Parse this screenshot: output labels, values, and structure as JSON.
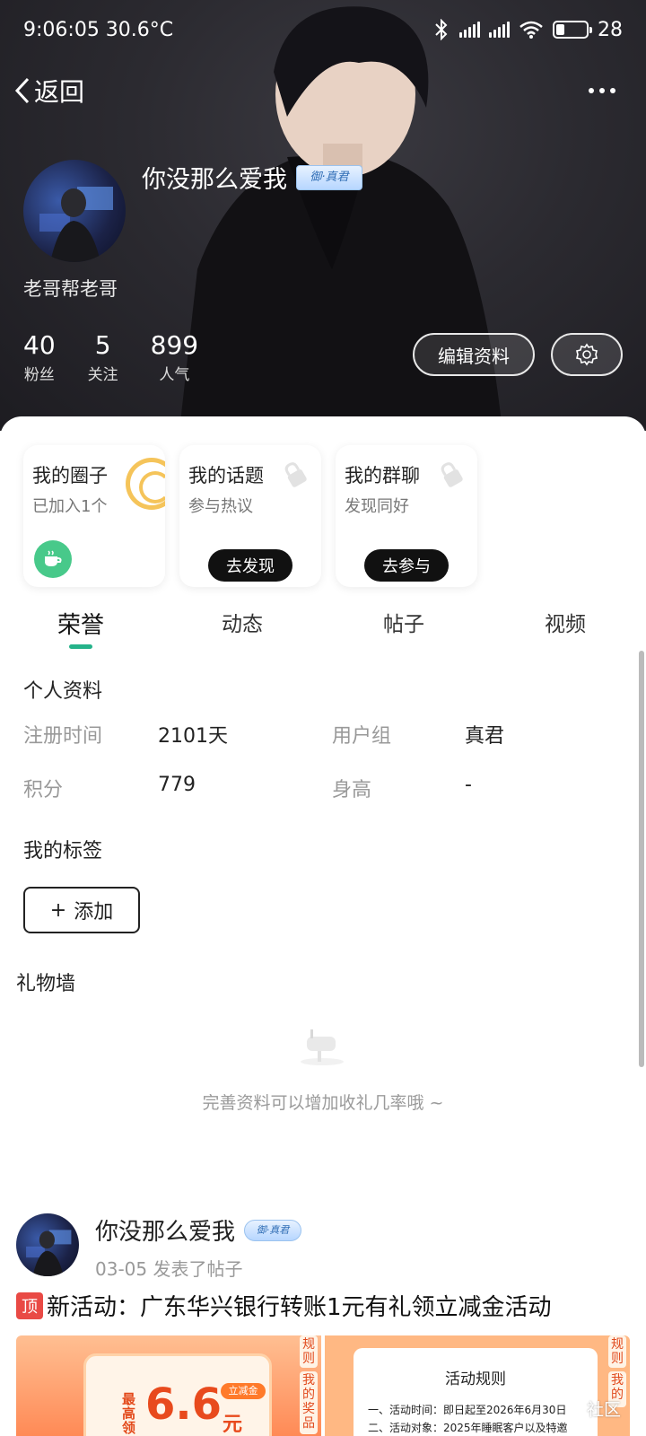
{
  "status_bar": {
    "time_temp": "9:06:05 30.6°C",
    "battery": "28",
    "battery_level": 0.28
  },
  "nav": {
    "back_label": "返回"
  },
  "profile": {
    "username": "你没那么爱我",
    "badge_text": "御·真君",
    "signature": "老哥帮老哥",
    "stats": [
      {
        "value": "40",
        "label": "粉丝"
      },
      {
        "value": "5",
        "label": "关注"
      },
      {
        "value": "899",
        "label": "人气"
      }
    ],
    "edit_label": "编辑资料"
  },
  "tiles": [
    {
      "title": "我的圈子",
      "subtitle": "已加入1个"
    },
    {
      "title": "我的话题",
      "subtitle": "参与热议",
      "button": "去发现"
    },
    {
      "title": "我的群聊",
      "subtitle": "发现同好",
      "button": "去参与"
    }
  ],
  "tabs": [
    {
      "label": "荣誉",
      "active": true
    },
    {
      "label": "动态",
      "active": false
    },
    {
      "label": "帖子",
      "active": false
    },
    {
      "label": "视频",
      "active": false
    }
  ],
  "personal": {
    "title": "个人资料",
    "fields": [
      {
        "label": "注册时间",
        "value": "2101天"
      },
      {
        "label": "用户组",
        "value": "真君"
      },
      {
        "label": "积分",
        "value": "779"
      },
      {
        "label": "身高",
        "value": "-"
      }
    ]
  },
  "tags": {
    "title": "我的标签",
    "add_label": "添加",
    "add_symbol": "+"
  },
  "gift_wall": {
    "title": "礼物墙",
    "empty_text": "完善资料可以增加收礼几率哦 ~"
  },
  "post": {
    "author": "你没那么爱我",
    "badge_text": "御·真君",
    "meta": "03-05 发表了帖子",
    "top_tag": "顶",
    "title": "新活动：广东华兴银行转账1元有礼领立减金活动",
    "promo": {
      "small": "最高领",
      "amount": "6.6",
      "unit": "元",
      "chip": "立减金",
      "side_tabs": [
        "规则",
        "我的奖品"
      ]
    },
    "rules": {
      "title": "活动规则",
      "lines": [
        "一、活动时间：即日起至2026年6月30日",
        "二、活动对象：2025年睡眠客户以及特邀"
      ],
      "side_tabs": [
        "规则",
        "我的"
      ]
    },
    "community_label": "社区"
  },
  "colors": {
    "accent": "#25b38a",
    "hero_bg": "#2b2a30",
    "top_tag": "#e94a45"
  }
}
